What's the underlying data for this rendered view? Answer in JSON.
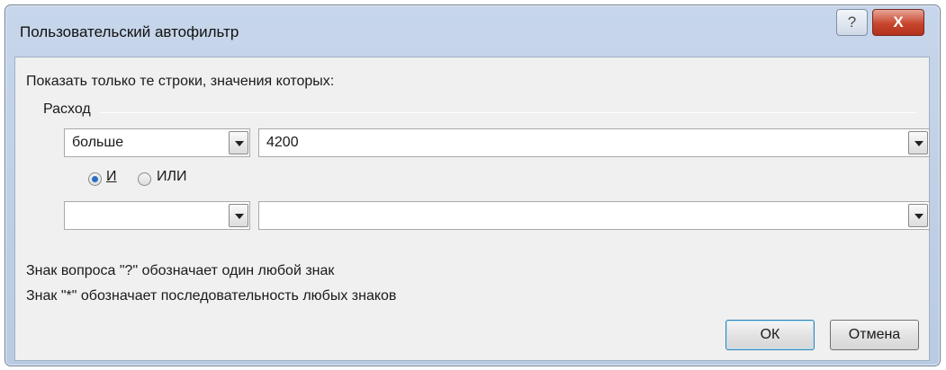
{
  "window": {
    "title": "Пользовательский автофильтр",
    "help_label": "?",
    "close_label": "X"
  },
  "dialog": {
    "instruction": "Показать только те строки, значения которых:",
    "field_name": "Расход",
    "row1": {
      "operator": "больше",
      "value": "4200"
    },
    "logic": {
      "and_label": "И",
      "or_label": "ИЛИ",
      "selected": "И"
    },
    "row2": {
      "operator": "",
      "value": ""
    },
    "hint1": "Знак вопроса \"?\" обозначает один любой знак",
    "hint2": "Знак \"*\" обозначает последовательность любых знаков",
    "ok_label": "ОК",
    "cancel_label": "Отмена"
  }
}
